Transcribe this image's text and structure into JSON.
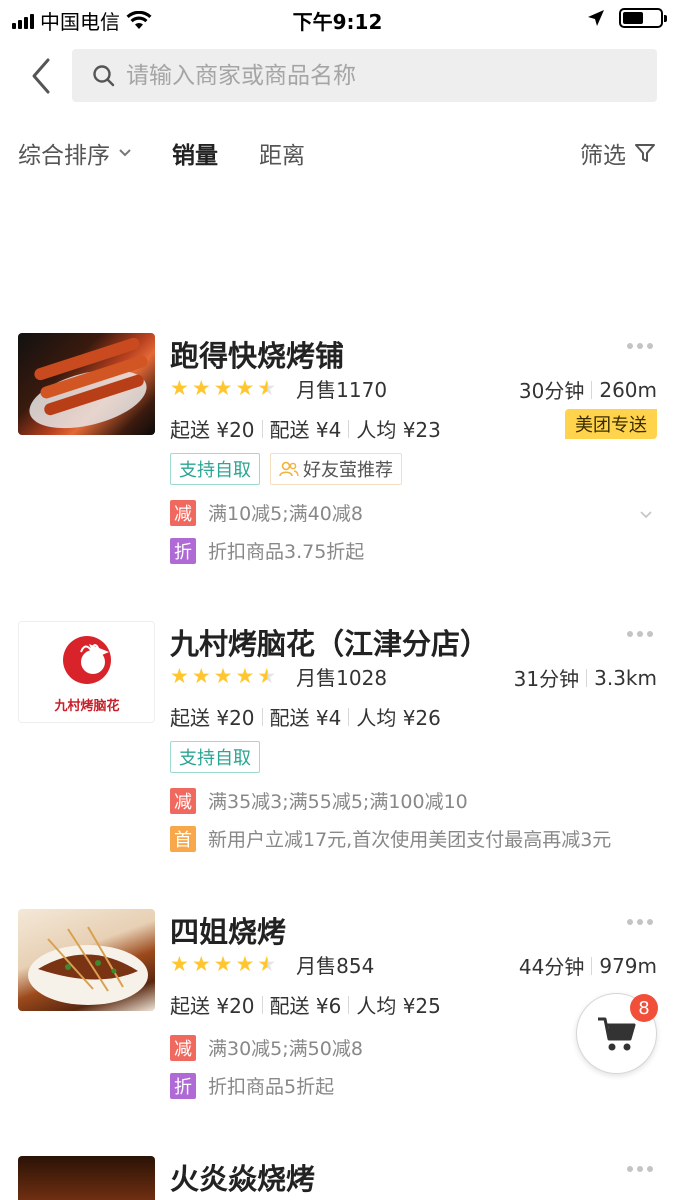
{
  "status_bar": {
    "carrier": "中国电信",
    "time": "下午9:12"
  },
  "search": {
    "placeholder": "请输入商家或商品名称"
  },
  "filters": {
    "sort": "综合排序",
    "sales": "销量",
    "distance": "距离",
    "filter": "筛选"
  },
  "stores": [
    {
      "name": "跑得快烧烤铺",
      "rating": 4.5,
      "monthly_sales": "月售1170",
      "delivery_time": "30分钟",
      "distance": "260m",
      "min_order": "起送 ¥20",
      "delivery_fee": "配送 ¥4",
      "per_capita": "人均 ¥23",
      "badge": "美团专送",
      "tags": [
        "支持自取",
        "好友萤推荐"
      ],
      "promos": [
        {
          "type": "减",
          "text": "满10减5;满40减8"
        },
        {
          "type": "折",
          "text": "折扣商品3.75折起"
        }
      ]
    },
    {
      "name": "九村烤脑花（江津分店）",
      "rating": 4.5,
      "monthly_sales": "月售1028",
      "delivery_time": "31分钟",
      "distance": "3.3km",
      "min_order": "起送 ¥20",
      "delivery_fee": "配送 ¥4",
      "per_capita": "人均 ¥26",
      "logo_text": "九村烤脑花",
      "tags": [
        "支持自取"
      ],
      "promos": [
        {
          "type": "减",
          "text": "满35减3;满55减5;满100减10"
        },
        {
          "type": "首",
          "text": "新用户立减17元,首次使用美团支付最高再减3元"
        }
      ]
    },
    {
      "name": "四姐烧烤",
      "rating": 4.5,
      "monthly_sales": "月售854",
      "delivery_time": "44分钟",
      "distance": "979m",
      "min_order": "起送 ¥20",
      "delivery_fee": "配送 ¥6",
      "per_capita": "人均 ¥25",
      "promos": [
        {
          "type": "减",
          "text": "满30减5;满50减8"
        },
        {
          "type": "折",
          "text": "折扣商品5折起"
        }
      ]
    },
    {
      "name": "火炎焱烧烤"
    }
  ],
  "cart": {
    "count": "8"
  },
  "colors": {
    "star": "#ffc630",
    "badge_yellow": "#ffd34c",
    "tag_green": "#2aa693",
    "promo_red": "#f0695f",
    "promo_purple": "#b06ad6",
    "promo_orange": "#f8a84a",
    "cart_badge": "#f24f3b"
  }
}
